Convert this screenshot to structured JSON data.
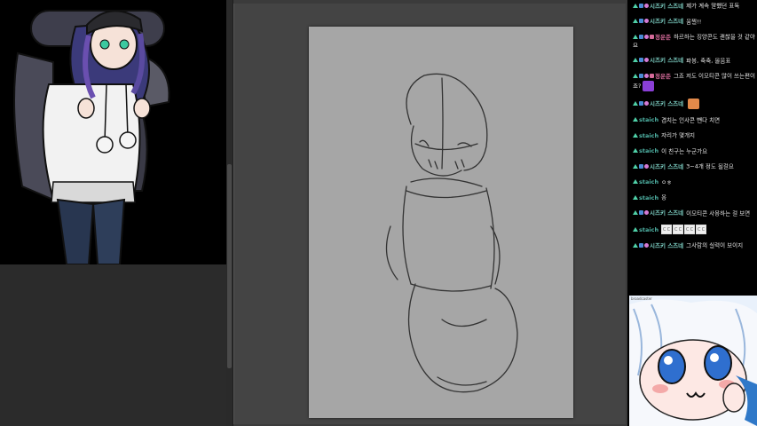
{
  "chat": {
    "messages": [
      {
        "user": "시즈키 스즈네",
        "user_color": "#7fd3c7",
        "text": "제가 계속 말했던 표독",
        "badges": [
          "up",
          "sq",
          "ht"
        ],
        "emote": null
      },
      {
        "user": "시즈키 스즈네",
        "user_color": "#7fd3c7",
        "text": "움찔!!",
        "badges": [
          "up",
          "sq",
          "ht"
        ],
        "emote": null
      },
      {
        "user": "정운준",
        "user_color": "#d66b9a",
        "text": "하르하는 징양콘도 괜찮을 것 같아요",
        "badges": [
          "up",
          "sq",
          "ht",
          "tag"
        ],
        "emote": null
      },
      {
        "user": "시즈키 스즈네",
        "user_color": "#7fd3c7",
        "text": "파봉, 축축, 몰음표",
        "badges": [
          "up",
          "sq",
          "ht"
        ],
        "emote": null
      },
      {
        "user": "정운준",
        "user_color": "#d66b9a",
        "text": "그죠 저도 이모티콘 많이 쓰는편이죠?",
        "badges": [
          "up",
          "sq",
          "ht",
          "tag"
        ],
        "emote": "purple"
      },
      {
        "user": "시즈키 스즈네",
        "user_color": "#7fd3c7",
        "text": "",
        "badges": [
          "up",
          "sq",
          "ht"
        ],
        "emote": "orange"
      },
      {
        "user": "staich",
        "user_color": "#4fb3a5",
        "text": "겹치는 인사콘 뺀다 치면",
        "badges": [
          "up"
        ],
        "emote": null
      },
      {
        "user": "staich",
        "user_color": "#4fb3a5",
        "text": "자리가 몇개지",
        "badges": [
          "up"
        ],
        "emote": null
      },
      {
        "user": "staich",
        "user_color": "#4fb3a5",
        "text": "이 친구는 누군가요",
        "badges": [
          "up"
        ],
        "emote": null
      },
      {
        "user": "시즈키 스즈네",
        "user_color": "#7fd3c7",
        "text": "3~4개 정도 될걸요",
        "badges": [
          "up",
          "sq",
          "ht"
        ],
        "emote": null
      },
      {
        "user": "staich",
        "user_color": "#4fb3a5",
        "text": "ㅇㅎ",
        "badges": [
          "up"
        ],
        "emote": null
      },
      {
        "user": "staich",
        "user_color": "#4fb3a5",
        "text": "옹",
        "badges": [
          "up"
        ],
        "emote": null
      },
      {
        "user": "시즈키 스즈네",
        "user_color": "#7fd3c7",
        "text": "이모티콘 사용하는 걸 보면",
        "badges": [
          "up",
          "sq",
          "ht"
        ],
        "emote": null
      },
      {
        "user": "staich",
        "user_color": "#4fb3a5",
        "text": "",
        "badges": [
          "up"
        ],
        "emote": "boxes"
      },
      {
        "user": "시즈키 스즈네",
        "user_color": "#7fd3c7",
        "text": "그사람의 실력이 보이지",
        "badges": [
          "up",
          "sq",
          "ht"
        ],
        "emote": null
      }
    ]
  },
  "emote_box_text": "ㄷㄷ",
  "cam": {
    "label": "broadcaster"
  }
}
